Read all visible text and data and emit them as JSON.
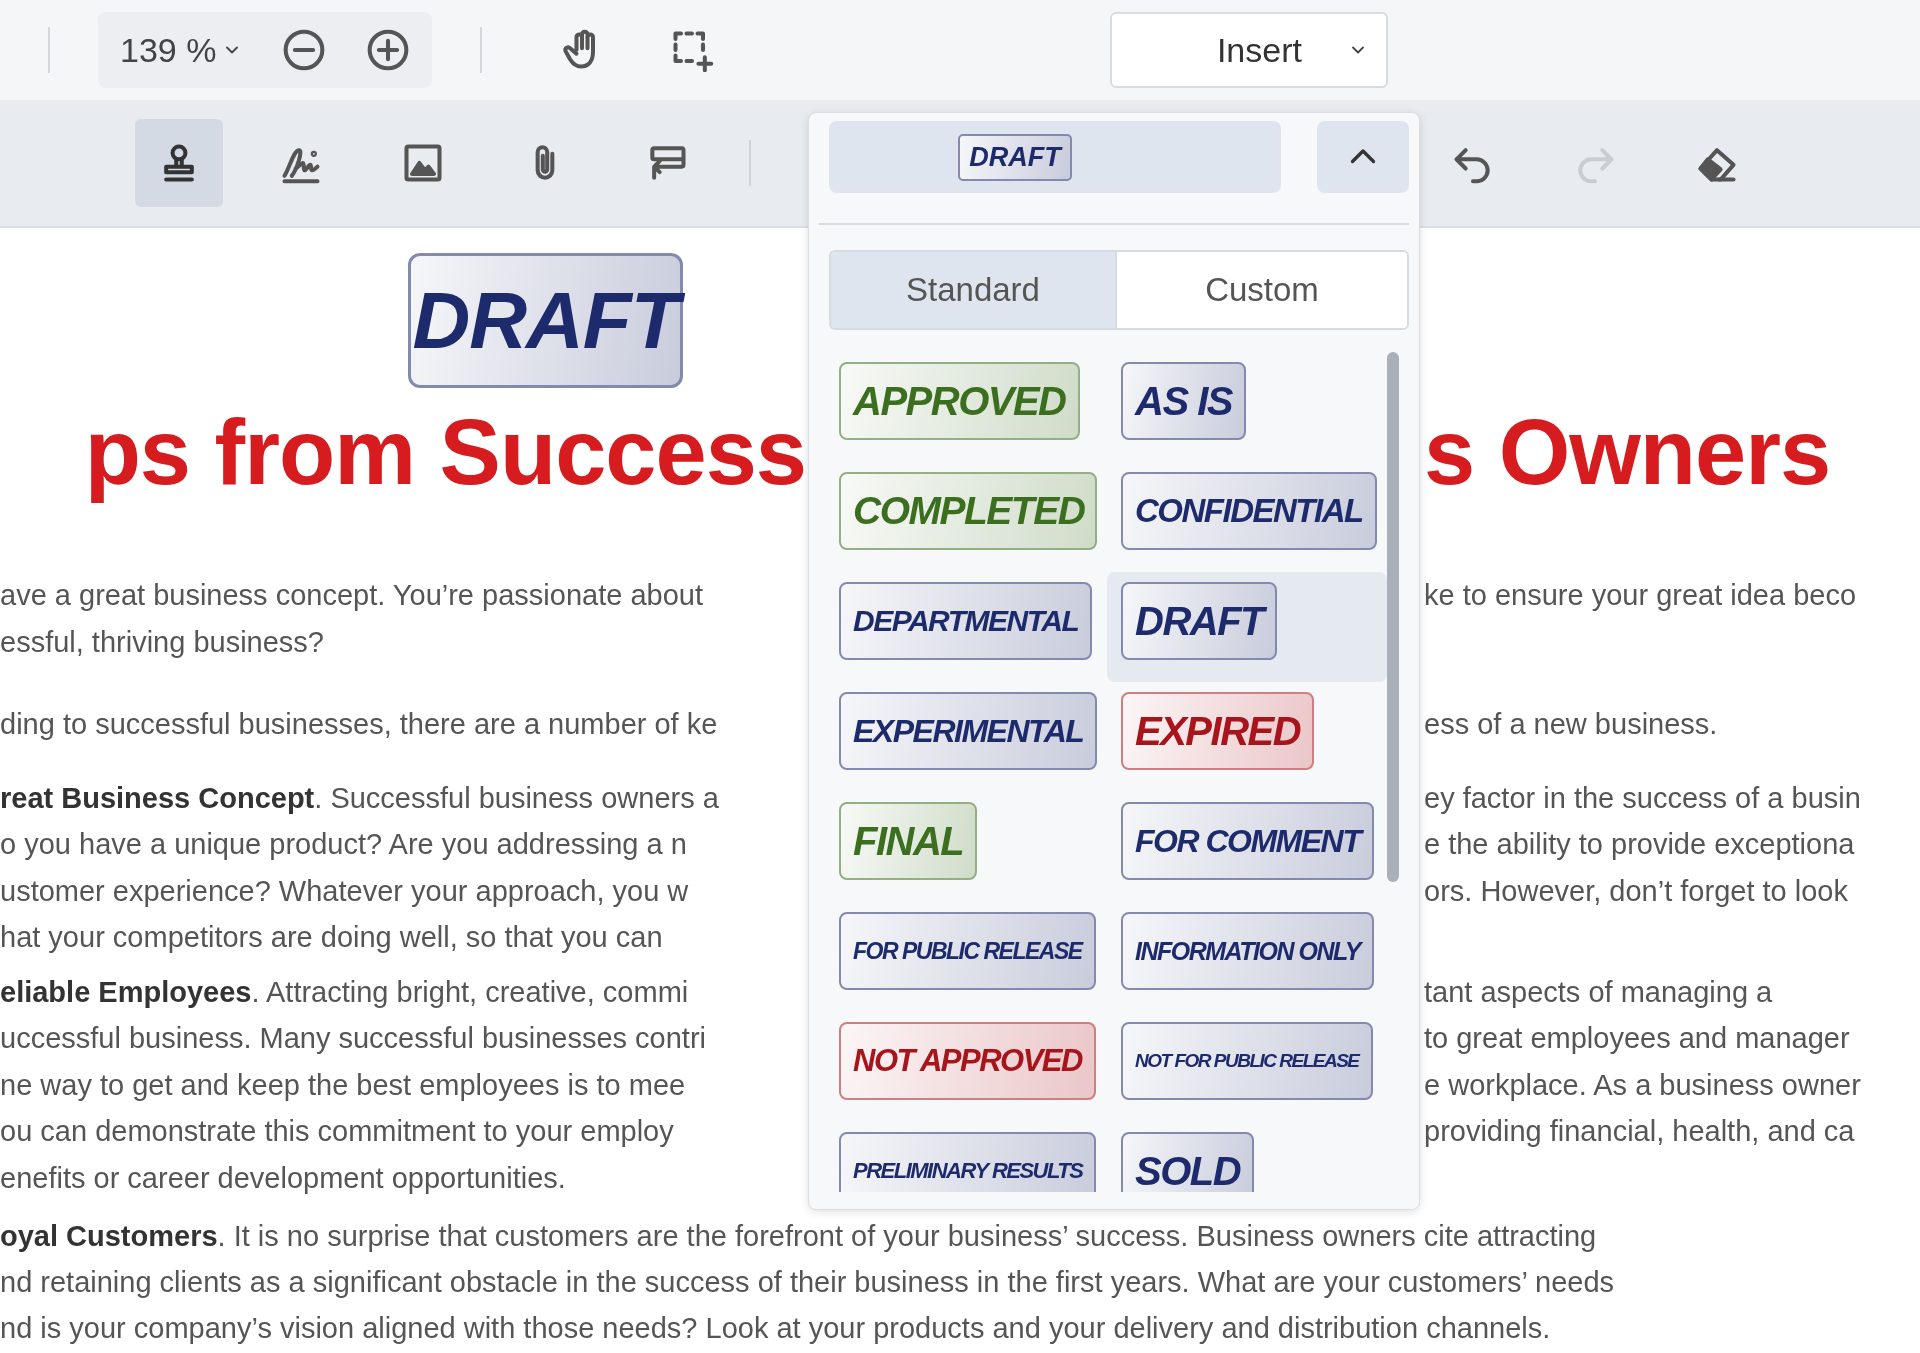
{
  "toolbar": {
    "zoom": "139 %",
    "view_tools": [
      {
        "kind": "pan",
        "selected": false
      },
      {
        "kind": "select-area",
        "selected": false
      }
    ],
    "insert_menu": "Insert"
  },
  "annotation_toolbar": {
    "tools": [
      {
        "kind": "stamp",
        "selected": true
      },
      {
        "kind": "signature",
        "selected": false
      },
      {
        "kind": "image",
        "selected": false
      },
      {
        "kind": "attachment",
        "selected": false
      },
      {
        "kind": "form-field",
        "selected": false
      }
    ],
    "history": [
      {
        "kind": "undo",
        "disabled": false
      },
      {
        "kind": "redo",
        "disabled": true
      },
      {
        "kind": "eraser",
        "disabled": false
      }
    ]
  },
  "stamp_picker": {
    "expanded": true,
    "preview": {
      "label": "DRAFT",
      "color": "#1d2a6b"
    },
    "tabs": [
      {
        "label": "Standard",
        "selected": true
      },
      {
        "label": "Custom",
        "selected": false
      }
    ],
    "stamps": [
      {
        "label": "APPROVED",
        "color": "#3b6e1e",
        "selected": false
      },
      {
        "label": "AS IS",
        "color": "#1d2a6b",
        "selected": false
      },
      {
        "label": "COMPLETED",
        "color": "#3b6e1e",
        "selected": false
      },
      {
        "label": "CONFIDENTIAL",
        "color": "#1d2a6b",
        "selected": false
      },
      {
        "label": "DEPARTMENTAL",
        "color": "#1d2a6b",
        "selected": false
      },
      {
        "label": "DRAFT",
        "color": "#1d2a6b",
        "selected": true
      },
      {
        "label": "EXPERIMENTAL",
        "color": "#1d2a6b",
        "selected": false
      },
      {
        "label": "EXPIRED",
        "color": "#a8141c",
        "selected": false
      },
      {
        "label": "FINAL",
        "color": "#3b6e1e",
        "selected": false
      },
      {
        "label": "FOR COMMENT",
        "color": "#1d2a6b",
        "selected": false
      },
      {
        "label": "FOR PUBLIC RELEASE",
        "color": "#1d2a6b",
        "selected": false
      },
      {
        "label": "INFORMATION ONLY",
        "color": "#1d2a6b",
        "selected": false
      },
      {
        "label": "NOT APPROVED",
        "color": "#a8141c",
        "selected": false
      },
      {
        "label": "NOT FOR PUBLIC RELEASE",
        "color": "#1d2a6b",
        "selected": false
      },
      {
        "label": "PRELIMINARY RESULTS",
        "color": "#1d2a6b",
        "selected": false
      },
      {
        "label": "SOLD",
        "color": "#1d2a6b",
        "selected": false
      }
    ]
  },
  "document": {
    "stamp": {
      "label": "DRAFT",
      "color": "#1d2a6b"
    },
    "heading": {
      "left": "ps from Success",
      "right": "s Owners"
    },
    "paragraphs": [
      {
        "lines": [
          {
            "left": "ave a great business concept. You’re passionate about",
            "right": "ke to ensure your great idea beco"
          },
          {
            "left": "essful, thriving business?"
          }
        ]
      },
      {
        "lines": [
          {
            "left": "ding to successful businesses, there are a number of ke",
            "right": "ess of a new business."
          }
        ]
      },
      {
        "lines": [
          {
            "left": "**reat Business Concept**. Successful business owners a",
            "right": "ey factor in the success of a busin"
          },
          {
            "left": "o you have a unique product? Are you addressing a n",
            "right": "e the ability to provide exceptiona"
          },
          {
            "left": "ustomer experience? Whatever your approach, you w",
            "right": "ors. However, don’t forget to look"
          },
          {
            "left": "hat your competitors are doing well, so that you can"
          }
        ]
      },
      {
        "lines": [
          {
            "left": "**eliable Employees**. Attracting bright, creative, commi",
            "right": "tant aspects of managing a"
          },
          {
            "left": "uccessful business. Many successful businesses contri",
            "right": "to great employees and manager"
          },
          {
            "left": "ne way to get and keep the best employees is to mee",
            "right": "e workplace. As a business owner"
          },
          {
            "left": "ou can demonstrate this commitment to your employ",
            "right": "providing financial, health, and ca"
          },
          {
            "left": "enefits or career development opportunities."
          }
        ]
      },
      {
        "lines": [
          {
            "text": "**oyal Customers**. It is no surprise that customers are the forefront of your business’ success. Business owners cite attracting"
          },
          {
            "text": "nd retaining clients as a significant obstacle in the success of their business in the first years. What are your customers’ needs"
          },
          {
            "text": "nd is your company’s vision aligned with those needs? Look at your products and your delivery and distribution channels."
          }
        ]
      }
    ]
  }
}
